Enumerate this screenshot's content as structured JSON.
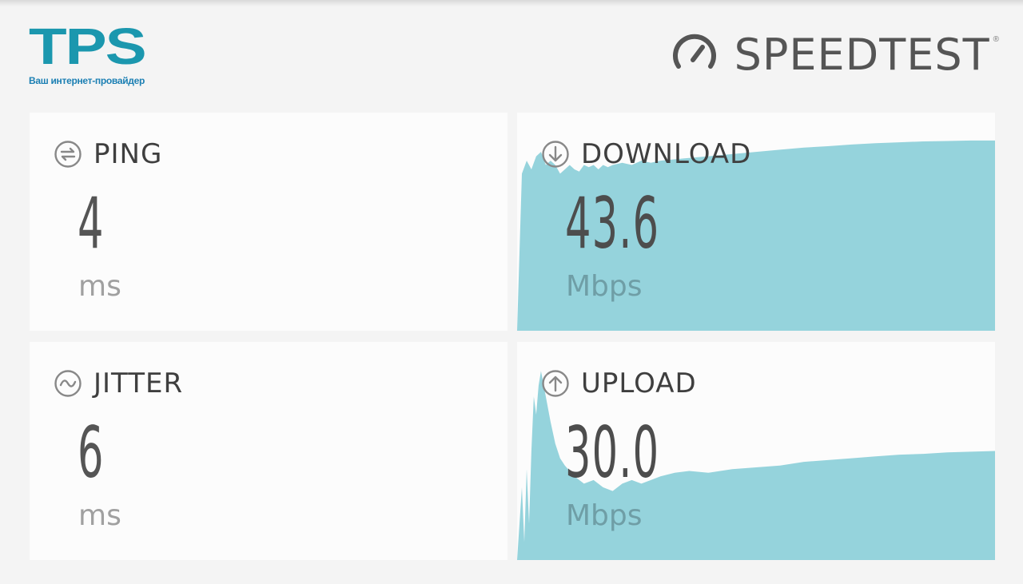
{
  "branding": {
    "provider_logo_text": "TPS",
    "provider_tagline": "Ваш интернет-провайдер",
    "speedtest_logo_text": "SPEEDTEST",
    "speedtest_registered": "®",
    "brand_color": "#1b97ae"
  },
  "results": {
    "ping": {
      "label": "PING",
      "value": "4",
      "unit": "ms",
      "icon": "ping-icon"
    },
    "download": {
      "label": "DOWNLOAD",
      "value": "43.6",
      "unit": "Mbps",
      "icon": "download-arrow-icon"
    },
    "jitter": {
      "label": "JITTER",
      "value": "6",
      "unit": "ms",
      "icon": "jitter-wave-icon"
    },
    "upload": {
      "label": "UPLOAD",
      "value": "30.0",
      "unit": "Mbps",
      "icon": "upload-arrow-icon"
    }
  },
  "colors": {
    "chart_fill": "#95d3dc",
    "card_bg": "#fcfcfc",
    "page_bg": "#f4f4f4"
  },
  "chart_data": [
    {
      "type": "area",
      "name": "download-speed-graph",
      "x": [
        0,
        1,
        2,
        3,
        4,
        5,
        6,
        7,
        8,
        9,
        10,
        11,
        12,
        13,
        14,
        15,
        16,
        17,
        18,
        19,
        20,
        22,
        24,
        26,
        28,
        30,
        35,
        40,
        45,
        50,
        55,
        60,
        65,
        70,
        75,
        80,
        85,
        90,
        95,
        100
      ],
      "y": [
        0,
        36,
        39,
        37,
        40,
        41,
        38,
        39,
        38,
        36,
        37,
        38,
        37,
        36.5,
        38,
        37.5,
        38,
        37,
        38,
        37.5,
        38,
        38.5,
        38,
        39,
        38.5,
        39,
        39.5,
        40,
        40.5,
        41,
        41.5,
        42,
        42.3,
        42.7,
        43,
        43.2,
        43.4,
        43.5,
        43.6,
        43.6
      ],
      "ylim": [
        0,
        50
      ]
    },
    {
      "type": "area",
      "name": "upload-speed-graph",
      "x": [
        0,
        1,
        1.5,
        2,
        2.5,
        3,
        3.5,
        4,
        4.5,
        5,
        6,
        7,
        8,
        9,
        10,
        12,
        14,
        16,
        18,
        20,
        22,
        24,
        26,
        28,
        30,
        33,
        36,
        40,
        45,
        50,
        55,
        60,
        65,
        70,
        75,
        80,
        85,
        90,
        95,
        100
      ],
      "y": [
        0,
        20,
        5,
        25,
        10,
        30,
        45,
        40,
        48,
        52,
        45,
        38,
        32,
        28,
        26,
        23,
        21,
        22,
        20,
        19,
        21,
        22,
        21,
        22,
        23,
        24,
        24.5,
        24,
        25,
        25.5,
        26,
        27,
        27.5,
        28,
        28.5,
        29,
        29.2,
        29.6,
        29.8,
        30
      ],
      "ylim": [
        0,
        60
      ]
    }
  ]
}
